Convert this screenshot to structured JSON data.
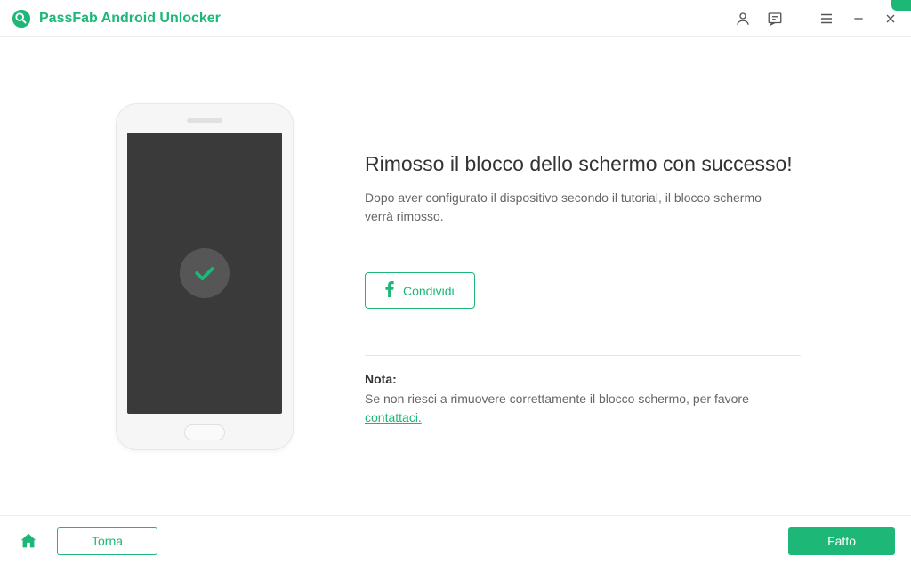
{
  "app": {
    "title": "PassFab Android Unlocker"
  },
  "main": {
    "heading": "Rimosso il blocco dello schermo con successo!",
    "subtext": "Dopo aver configurato il dispositivo secondo il tutorial, il blocco schermo verrà rimosso.",
    "share_label": "Condividi"
  },
  "note": {
    "label": "Nota:",
    "text": "Se non riesci a rimuovere correttamente il blocco schermo, per favore ",
    "link": "contattaci."
  },
  "footer": {
    "back_label": "Torna",
    "done_label": "Fatto"
  },
  "colors": {
    "accent": "#1db877"
  }
}
